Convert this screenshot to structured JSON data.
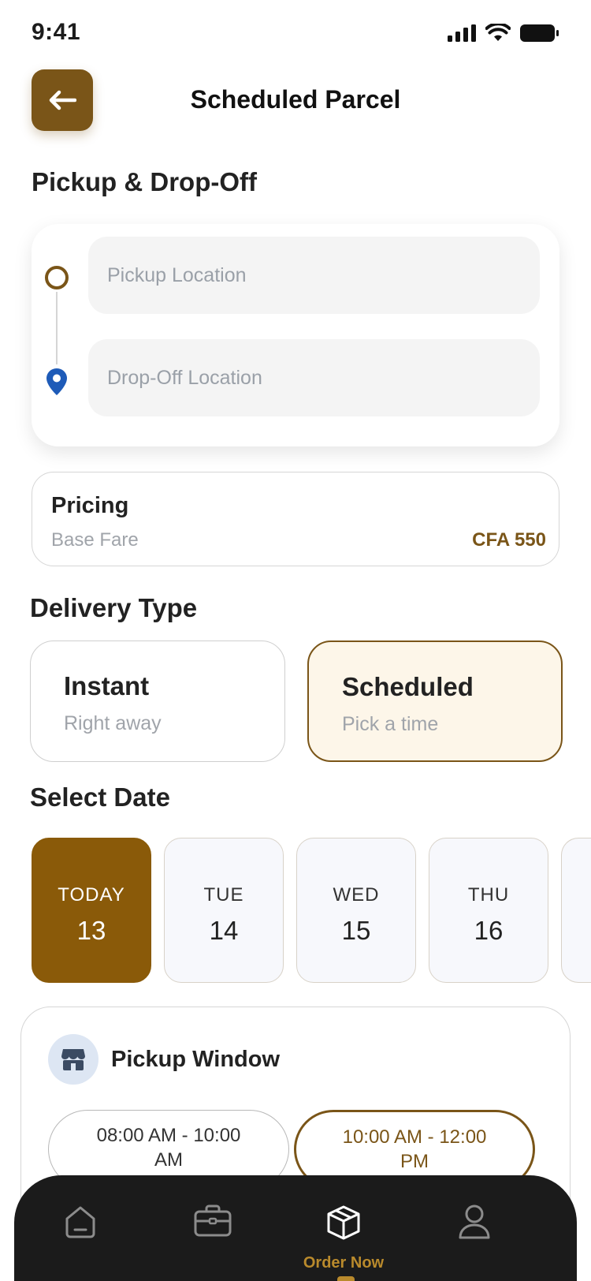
{
  "status_bar": {
    "time": "9:41"
  },
  "header": {
    "title": "Scheduled Parcel"
  },
  "sections": {
    "pickup_dropoff": "Pickup & Drop-Off",
    "delivery_type": "Delivery Type",
    "select_date": "Select Date"
  },
  "locations": {
    "pickup_placeholder": "Pickup Location",
    "dropoff_placeholder": "Drop-Off Location"
  },
  "pricing": {
    "title": "Pricing",
    "label": "Base Fare",
    "value": "CFA 550"
  },
  "delivery_types": [
    {
      "title": "Instant",
      "subtitle": "Right  away",
      "selected": false
    },
    {
      "title": "Scheduled",
      "subtitle": "Pick a time",
      "selected": true
    }
  ],
  "dates": [
    {
      "day": "TODAY",
      "num": "13",
      "selected": true
    },
    {
      "day": "TUE",
      "num": "14",
      "selected": false
    },
    {
      "day": "WED",
      "num": "15",
      "selected": false
    },
    {
      "day": "THU",
      "num": "16",
      "selected": false
    }
  ],
  "pickup_window": {
    "title": "Pickup Window",
    "icon": "store-icon",
    "slots": [
      {
        "line1": "08:00 AM - 10:00",
        "line2": "AM",
        "selected": false
      },
      {
        "line1": "10:00 AM - 12:00",
        "line2": "PM",
        "selected": true
      }
    ]
  },
  "bottom_nav": {
    "items": [
      {
        "icon": "home-icon",
        "label": ""
      },
      {
        "icon": "briefcase-icon",
        "label": ""
      },
      {
        "icon": "package-icon",
        "label": "Order Now",
        "active": true
      },
      {
        "icon": "user-icon",
        "label": ""
      }
    ]
  },
  "colors": {
    "brand": "#7a5518",
    "brand_date": "#8a5a09",
    "accent_label": "#b98a2c",
    "nav_bg": "#1b1b1b",
    "pin_blue": "#1e5bb8",
    "selected_bg": "#fdf6e9"
  }
}
